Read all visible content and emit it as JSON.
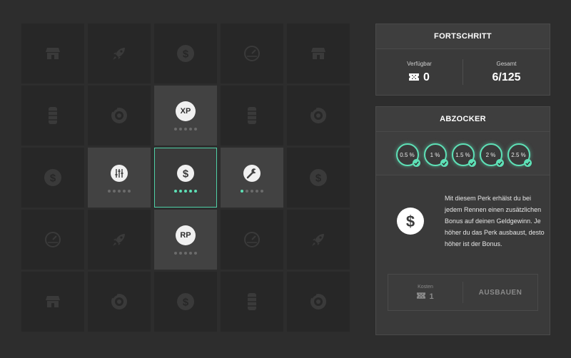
{
  "grid": {
    "rows": [
      [
        "shop",
        "rocket",
        "dollar",
        "gauge",
        "shop"
      ],
      [
        "tire",
        "brake",
        "xp",
        "tire",
        "brake"
      ],
      [
        "dollar",
        "sliders",
        "dollar",
        "wrench",
        "dollar"
      ],
      [
        "gauge",
        "rocket",
        "rp",
        "gauge",
        "rocket"
      ],
      [
        "shop",
        "brake",
        "dollar",
        "tire",
        "brake"
      ]
    ],
    "badges": {
      "xp": "XP",
      "rp": "RP"
    },
    "active_cells": [
      {
        "row": 1,
        "col": 2,
        "icon": "xp",
        "level": 0
      },
      {
        "row": 2,
        "col": 1,
        "icon": "sliders",
        "level": 0
      },
      {
        "row": 2,
        "col": 2,
        "icon": "dollar",
        "level": 5,
        "selected": true
      },
      {
        "row": 2,
        "col": 3,
        "icon": "wrench",
        "level": 1
      },
      {
        "row": 3,
        "col": 2,
        "icon": "rp",
        "level": 0
      }
    ],
    "max_level": 5
  },
  "progress": {
    "title": "FORTSCHRITT",
    "available_label": "Verfügbar",
    "available_value": "0",
    "total_label": "Gesamt",
    "total_value": "6/125"
  },
  "perk": {
    "title": "ABZOCKER",
    "levels": [
      "0.5 %",
      "1 %",
      "1.5 %",
      "2 %",
      "2.5 %"
    ],
    "description": "Mit diesem Perk erhälst du bei jedem Rennen einen zusätzlichen Bonus auf deinen Geldgewinn. Je höher du das Perk ausbaust, desto höher ist der Bonus.",
    "cost_label": "Kosten",
    "cost_value": "1",
    "upgrade_label": "AUSBAUEN"
  },
  "colors": {
    "accent": "#5ee0b6",
    "dim_icon": "#3a3a3a",
    "bright_icon": "#f0f0f0"
  }
}
